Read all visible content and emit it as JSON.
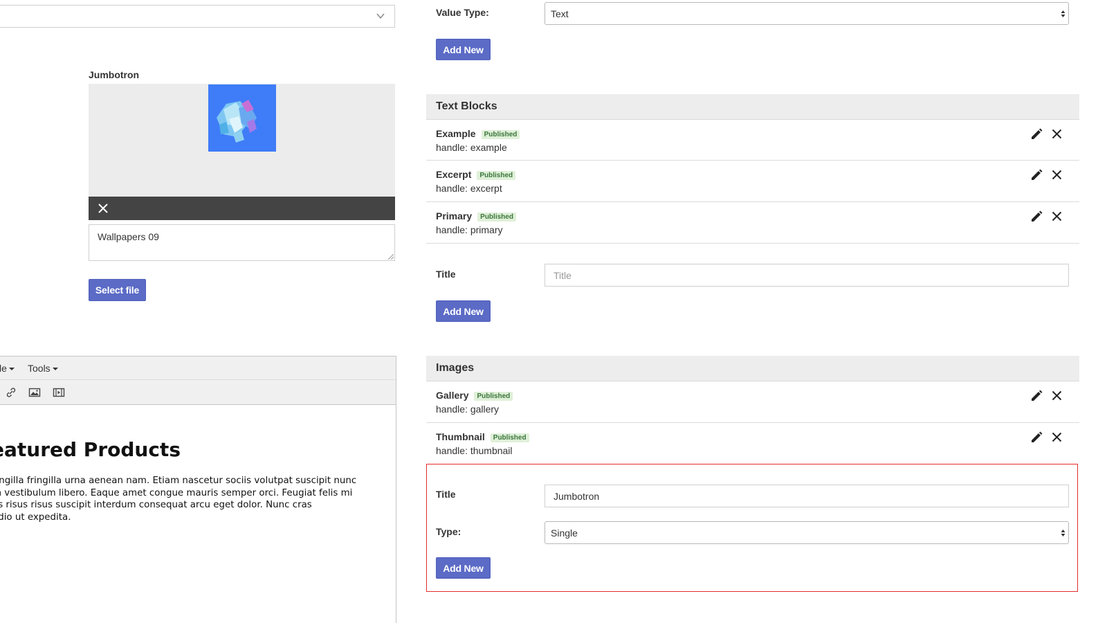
{
  "left_panel": {
    "jumbotron_label": "Jumbotron",
    "caption_value": "Wallpapers 09",
    "select_file_label": "Select file"
  },
  "editor": {
    "menus": [
      {
        "label": "le"
      },
      {
        "label": "Tools"
      }
    ],
    "heading": "eatured Products",
    "paragraph_lines": [
      "ringilla fringilla urna aenean nam. Etiam nascetur sociis volutpat suscipit nunc",
      "m vestibulum libero. Eaque amet congue mauris semper orci. Feugiat felis mi",
      "os risus risus suscipit interdum consequat arcu eget dolor. Nunc cras",
      "odio ut expedita."
    ]
  },
  "value_type": {
    "label": "Value Type:",
    "selected": "Text",
    "add_new_label": "Add New"
  },
  "text_blocks": {
    "title": "Text Blocks",
    "items": [
      {
        "name": "Example",
        "status": "Published",
        "handle": "handle: example"
      },
      {
        "name": "Excerpt",
        "status": "Published",
        "handle": "handle: excerpt"
      },
      {
        "name": "Primary",
        "status": "Published",
        "handle": "handle: primary"
      }
    ],
    "form": {
      "title_label": "Title",
      "title_placeholder": "Title",
      "add_new_label": "Add New"
    }
  },
  "images": {
    "title": "Images",
    "items": [
      {
        "name": "Gallery",
        "status": "Published",
        "handle": "handle: gallery"
      },
      {
        "name": "Thumbnail",
        "status": "Published",
        "handle": "handle: thumbnail"
      }
    ],
    "form": {
      "title_label": "Title",
      "title_value": "Jumbotron",
      "type_label": "Type:",
      "type_selected": "Single",
      "add_new_label": "Add New"
    }
  },
  "colors": {
    "primary_button": "#5b6bc6",
    "highlight_border": "#e32b2b",
    "badge_bg": "#dff0d8",
    "badge_text": "#3c763d"
  }
}
